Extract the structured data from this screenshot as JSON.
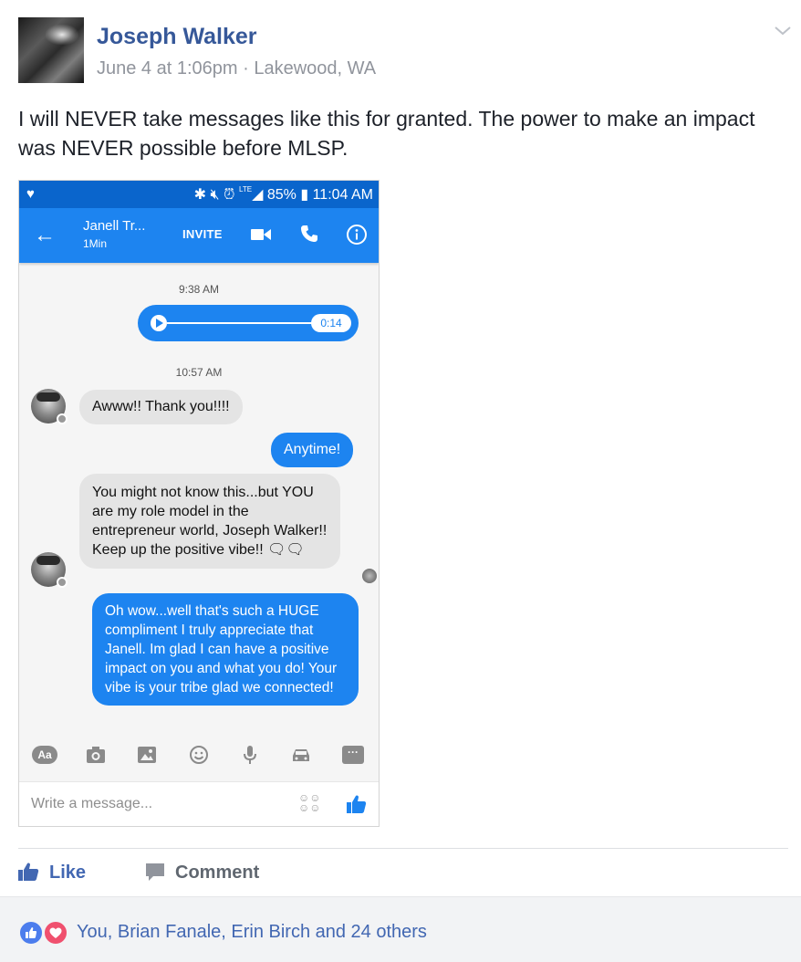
{
  "post": {
    "author": "Joseph Walker",
    "date": "June 4 at 1:06pm",
    "separator": "·",
    "location": "Lakewood, WA",
    "text": "I will NEVER take messages like this for granted. The power to make an impact was NEVER possible before MLSP."
  },
  "screenshot": {
    "status_bar": {
      "battery": "85%",
      "time": "11:04 AM",
      "network": "LTE"
    },
    "app_bar": {
      "contact_name": "Janell Tr...",
      "contact_status": "1Min",
      "invite_label": "INVITE"
    },
    "timestamps": [
      "9:38 AM",
      "10:57 AM"
    ],
    "audio_message": {
      "duration": "0:14"
    },
    "messages": [
      {
        "direction": "in",
        "text": "Awww!! Thank you!!!!"
      },
      {
        "direction": "out",
        "text": "Anytime!"
      },
      {
        "direction": "in",
        "text": "You might not know this...but YOU are my role model in the entrepreneur world, Joseph Walker!! Keep up the positive vibe!! 🗨🗨"
      },
      {
        "direction": "out",
        "text": "Oh wow...well that's such a HUGE compliment I truly appreciate that Janell. Im glad I can have a positive impact on you and what you do! Your vibe is your tribe glad we connected!"
      }
    ],
    "composer": {
      "text_button": "Aa",
      "placeholder": "Write a message..."
    }
  },
  "actions": {
    "like_label": "Like",
    "comment_label": "Comment"
  },
  "reactions": {
    "summary": "You, Brian Fanale, Erin Birch and 24 others"
  },
  "colors": {
    "facebook_blue": "#365899",
    "messenger_blue": "#1d84f0",
    "status_bar_blue": "#0a65cc",
    "meta_gray": "#90949c"
  }
}
